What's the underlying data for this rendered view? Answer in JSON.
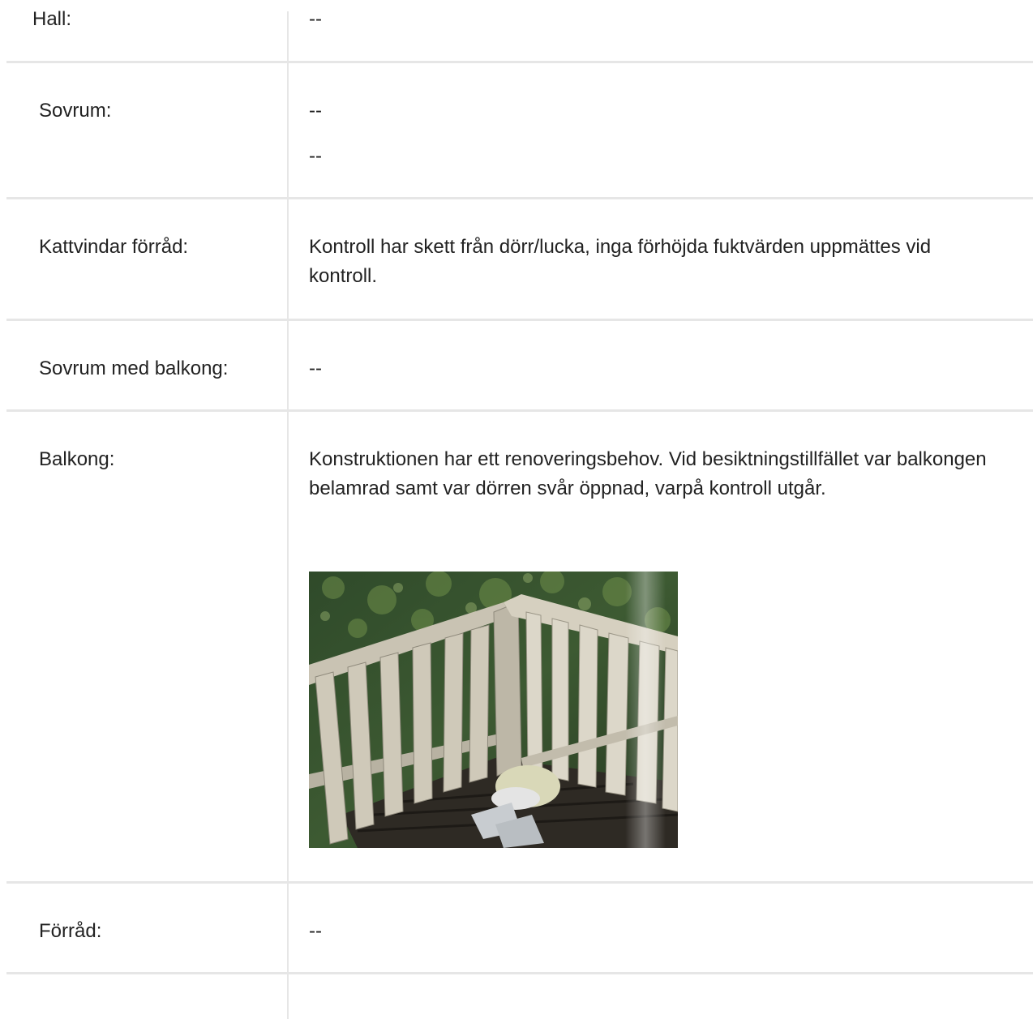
{
  "rows": [
    {
      "label": "Hall:",
      "values": [
        "--"
      ]
    },
    {
      "label": "Sovrum:",
      "values": [
        "--",
        "--"
      ]
    },
    {
      "label": "Kattvindar förråd:",
      "values": [
        "Kontroll har skett från dörr/lucka, inga förhöjda fuktvärden uppmättes vid kontroll."
      ]
    },
    {
      "label": "Sovrum med balkong:",
      "values": [
        "--"
      ]
    },
    {
      "label": "Balkong:",
      "values": [
        "Konstruktionen har ett renoveringsbehov. Vid besiktningstillfället var balkongen belamrad samt var dörren svår öppnad, varpå kontroll utgår."
      ]
    },
    {
      "label": "Förråd:",
      "values": [
        "--"
      ]
    }
  ]
}
